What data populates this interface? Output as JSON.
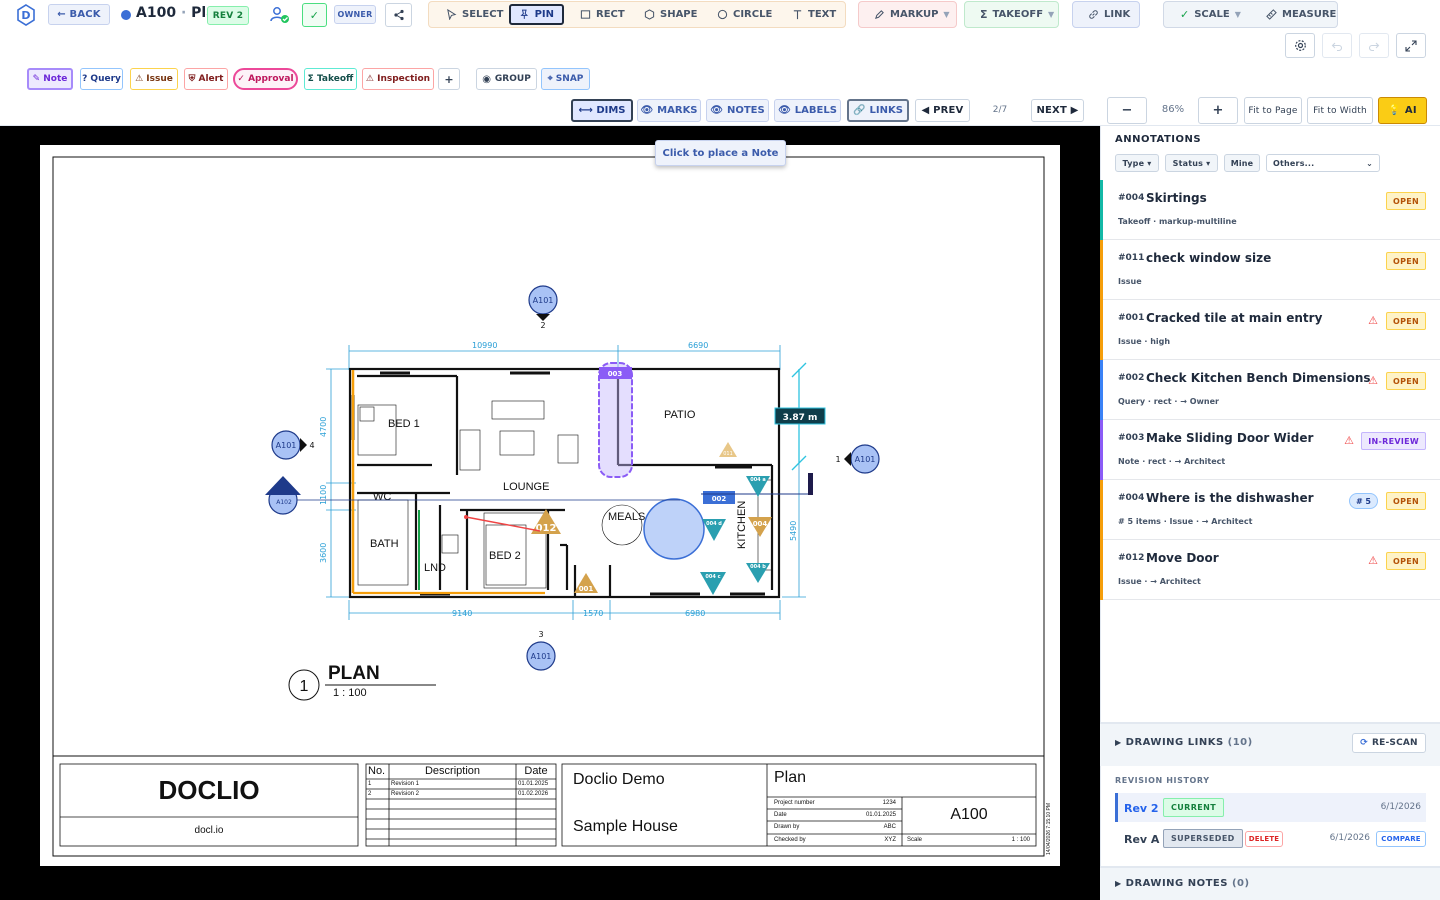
{
  "header": {
    "logo": "D",
    "back_label": "← BACK",
    "sheet_code": "A100",
    "sheet_sep": "·",
    "sheet_name": "Plan",
    "rev_badge": "REV 2",
    "check_label": "✓",
    "role_badge": "OWNER",
    "tools": {
      "select": "SELECT",
      "pin": "PIN",
      "rect": "RECT",
      "shape": "SHAPE",
      "circle": "CIRCLE",
      "text": "TEXT"
    },
    "markup": "MARKUP",
    "takeoff": "TAKEOFF",
    "link": "LINK",
    "scale": "SCALE",
    "measure": "MEASURE"
  },
  "pills": {
    "note": "✎ Note",
    "query": "? Query",
    "issue": "⚠ Issue",
    "alert": "⛨ Alert",
    "approval": "✓ Approval",
    "takeoff": "Σ Takeoff",
    "inspection": "⚠ Inspection",
    "add": "+",
    "group": "GROUP",
    "snap": "⌖ SNAP"
  },
  "view": {
    "dims": "⟷ DIMS",
    "marks": "MARKS",
    "notes": "NOTES",
    "labels": "LABELS",
    "links": "LINKS",
    "prev": "◀ PREV",
    "page": "2/7",
    "next": "NEXT ▶",
    "minus": "−",
    "zoom": "86%",
    "plus": "+",
    "fit_page": "Fit to Page",
    "fit_width": "Fit to Width",
    "ai": "AI"
  },
  "hint": "Click to place a Note",
  "drawing": {
    "rooms": {
      "bed1": "BED 1",
      "lounge": "LOUNGE",
      "patio": "PATIO",
      "wc": "WC",
      "bath": "BATH",
      "lnd": "LND",
      "bed2": "BED 2",
      "meals": "MEALS",
      "kitchen": "KITCHEN"
    },
    "dims": {
      "top_left": "10990",
      "top_right": "6690",
      "left_top": "4700",
      "left_mid": "1100",
      "left_bot": "3600",
      "bot_1": "9140",
      "bot_2": "1570",
      "bot_3": "6980",
      "right": "5490"
    },
    "measure": "3.87 m",
    "sections": {
      "top": "A101",
      "top_num": "2",
      "left": "A101",
      "left_num": "4",
      "left2": "A102",
      "right": "A101",
      "right_num": "1",
      "bottom": "A101",
      "bottom_num": "3"
    },
    "markers": {
      "m003": "003",
      "m002": "002",
      "m012": "012",
      "m001": "001",
      "m004": "004",
      "m004a": "004\na",
      "m004b": "004\nb",
      "m004c": "004\nc",
      "m004d": "004\nd",
      "m011": "011"
    },
    "plan_num": "1",
    "plan_title": "PLAN",
    "plan_scale": "1 : 100"
  },
  "titleblock": {
    "company": "DOCLIO",
    "url": "docl.io",
    "rev_headers": [
      "No.",
      "Description",
      "Date"
    ],
    "revisions": [
      [
        "1",
        "Revision 1",
        "01.01.2025"
      ],
      [
        "2",
        "Revision 2",
        "01.02.2026"
      ]
    ],
    "project": "Doclio Demo",
    "site": "Sample House",
    "sheet_title": "Plan",
    "fields": [
      [
        "Project number",
        "1234"
      ],
      [
        "Date",
        "01.01.2025"
      ],
      [
        "Drawn by",
        "ABC"
      ],
      [
        "Checked by",
        "XYZ"
      ]
    ],
    "scale_label": "Scale",
    "scale_value": "1 : 100",
    "sheet_no": "A100",
    "stamp": "14/04/2026 7:15:10 PM"
  },
  "panel": {
    "title": "ANNOTATIONS",
    "filters": {
      "type": "Type ▾",
      "status": "Status ▾",
      "mine": "Mine",
      "others": "Others..."
    },
    "items": [
      {
        "id": "#004",
        "title": "Skirtings",
        "meta": "Takeoff · markup-multiline",
        "status": "OPEN",
        "color": "#14b8a6",
        "warn": ""
      },
      {
        "id": "#011",
        "title": "check window size",
        "meta": "Issue",
        "status": "OPEN",
        "color": "#f59e0b",
        "warn": ""
      },
      {
        "id": "#001",
        "title": "Cracked tile at main entry",
        "meta": "Issue · high",
        "status": "OPEN",
        "color": "#f59e0b",
        "warn": "⚠"
      },
      {
        "id": "#002",
        "title": "Check Kitchen Bench Dimensions",
        "meta": "Query · rect · → Owner",
        "status": "OPEN",
        "color": "#3b82f6",
        "warn": "⚠"
      },
      {
        "id": "#003",
        "title": "Make Sliding Door Wider",
        "meta": "Note · rect · → Architect",
        "status": "IN-REVIEW",
        "color": "#8b5cf6",
        "warn": "⚠"
      },
      {
        "id": "#004",
        "title": "Where is the dishwasher",
        "meta": "# 5 items · Issue · → Architect",
        "status": "OPEN",
        "color": "#f59e0b",
        "warn": "",
        "count": "# 5"
      },
      {
        "id": "#012",
        "title": "Move Door",
        "meta": "Issue · → Architect",
        "status": "OPEN",
        "color": "#f59e0b",
        "warn": "⚠"
      }
    ],
    "links_label": "DRAWING LINKS",
    "links_count": "(10)",
    "rescan": "RE-SCAN",
    "history_title": "REVISION HISTORY",
    "rev2": "Rev 2",
    "rev2_status": "CURRENT",
    "rev2_date": "6/1/2026",
    "reva": "Rev A",
    "reva_status": "SUPERSEDED",
    "reva_delete": "DELETE",
    "reva_date": "6/1/2026",
    "reva_compare": "COMPARE",
    "notes_label": "DRAWING NOTES",
    "notes_count": "(0)"
  }
}
